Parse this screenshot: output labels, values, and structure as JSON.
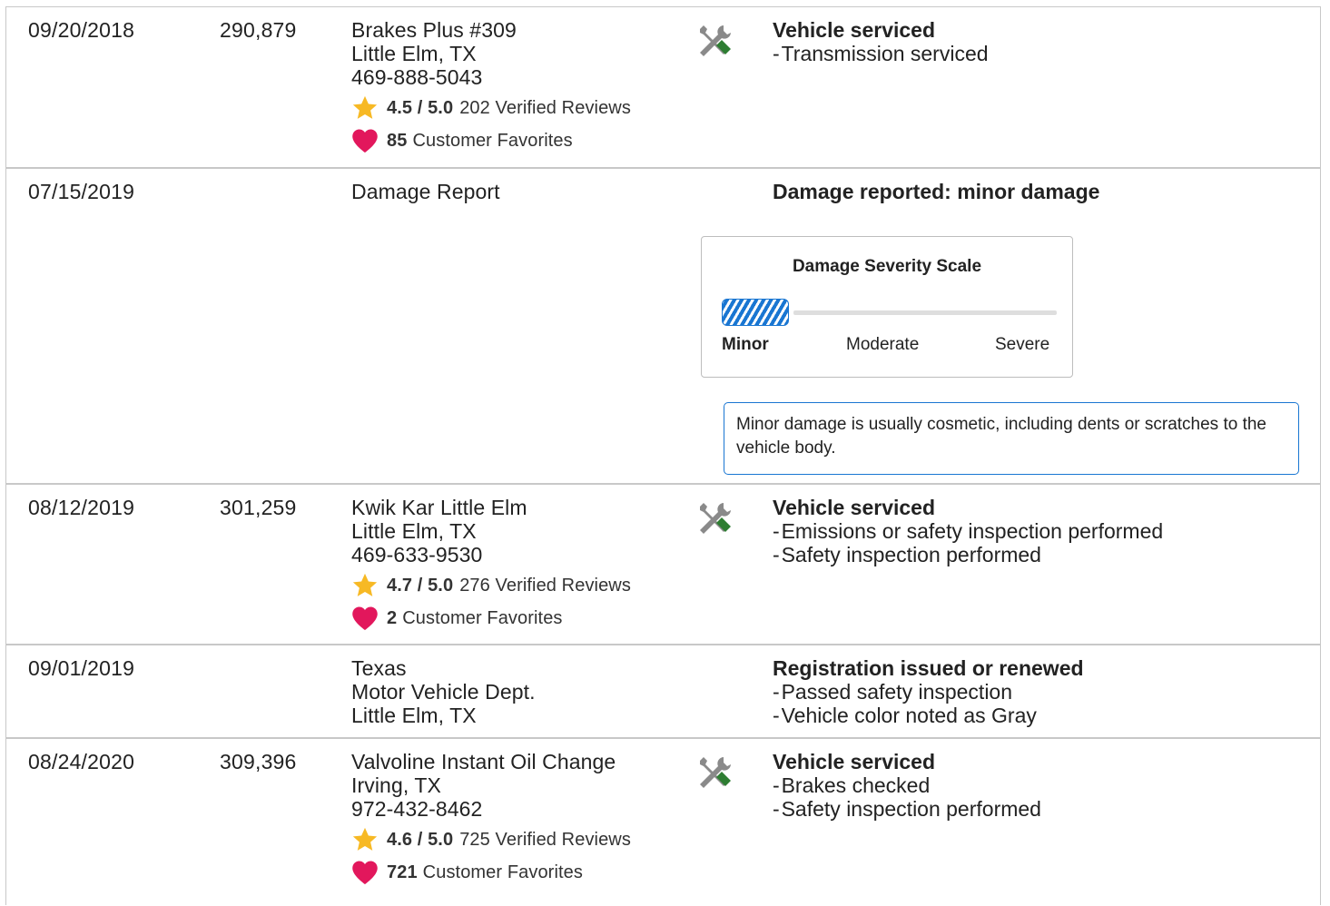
{
  "records": [
    {
      "date": "09/20/2018",
      "mileage": "290,879",
      "source_lines": [
        "Brakes Plus #309",
        "Little Elm, TX",
        "469-888-5043"
      ],
      "rating": "4.5 / 5.0",
      "reviews": "202 Verified Reviews",
      "favorites": "85",
      "favorites_label": "Customer Favorites",
      "icon": "service-tools-icon",
      "title": "Vehicle serviced",
      "items": [
        "Transmission serviced"
      ]
    },
    {
      "date": "07/15/2019",
      "mileage": "",
      "source_lines": [
        "Damage Report"
      ],
      "title": "Damage reported: minor damage",
      "severity_scale": {
        "title": "Damage Severity Scale",
        "labels": [
          "Minor",
          "Moderate",
          "Severe"
        ],
        "selected": "Minor",
        "color": "#1976d2"
      },
      "info_text": "Minor damage is usually cosmetic, including dents or scratches to the vehicle body."
    },
    {
      "date": "08/12/2019",
      "mileage": "301,259",
      "source_lines": [
        "Kwik Kar Little Elm",
        "Little Elm, TX",
        "469-633-9530"
      ],
      "rating": "4.7 / 5.0",
      "reviews": "276 Verified Reviews",
      "favorites": "2",
      "favorites_label": "Customer Favorites",
      "icon": "service-tools-icon",
      "title": "Vehicle serviced",
      "items": [
        "Emissions or safety inspection performed",
        "Safety inspection performed"
      ]
    },
    {
      "date": "09/01/2019",
      "mileage": "",
      "source_lines": [
        "Texas",
        "Motor Vehicle Dept.",
        "Little Elm, TX"
      ],
      "title": "Registration issued or renewed",
      "items": [
        "Passed safety inspection",
        "Vehicle color noted as Gray"
      ]
    },
    {
      "date": "08/24/2020",
      "mileage": "309,396",
      "source_lines": [
        "Valvoline Instant Oil Change",
        "Irving, TX",
        "972-432-8462"
      ],
      "rating": "4.6 / 5.0",
      "reviews": "725 Verified Reviews",
      "favorites": "721",
      "favorites_label": "Customer Favorites",
      "icon": "service-tools-icon",
      "title": "Vehicle serviced",
      "items": [
        "Brakes checked",
        "Safety inspection performed"
      ]
    }
  ],
  "colors": {
    "star": "#f7b924",
    "heart": "#e2175c",
    "wrench_gray": "#8a8a8a",
    "screwdriver_green": "#2e7d32",
    "accent_blue": "#1976d2",
    "border": "#c8c8c8"
  }
}
